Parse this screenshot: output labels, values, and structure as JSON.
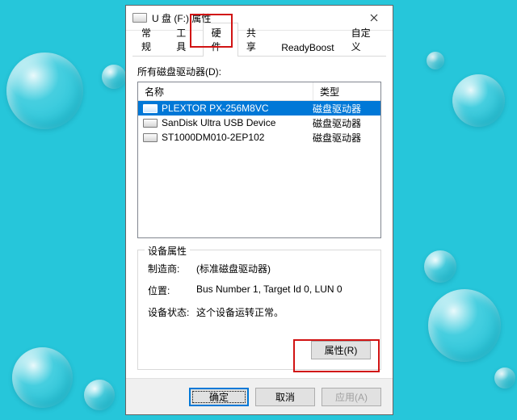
{
  "window": {
    "title": "U 盘 (F:) 属性"
  },
  "tabs": {
    "items": [
      {
        "label": "常规"
      },
      {
        "label": "工具"
      },
      {
        "label": "硬件"
      },
      {
        "label": "共享"
      },
      {
        "label": "ReadyBoost"
      },
      {
        "label": "自定义"
      }
    ],
    "active_index": 2
  },
  "list": {
    "caption": "所有磁盘驱动器(D):",
    "col_name": "名称",
    "col_type": "类型",
    "rows": [
      {
        "name": "PLEXTOR PX-256M8VC",
        "type": "磁盘驱动器",
        "selected": true
      },
      {
        "name": "SanDisk Ultra USB Device",
        "type": "磁盘驱动器",
        "selected": false
      },
      {
        "name": "ST1000DM010-2EP102",
        "type": "磁盘驱动器",
        "selected": false
      }
    ]
  },
  "device_props": {
    "legend": "设备属性",
    "manufacturer_label": "制造商:",
    "manufacturer_value": "(标准磁盘驱动器)",
    "location_label": "位置:",
    "location_value": "Bus Number 1, Target Id 0, LUN 0",
    "status_label": "设备状态:",
    "status_value": "这个设备运转正常。",
    "properties_button": "属性(R)"
  },
  "footer": {
    "ok": "确定",
    "cancel": "取消",
    "apply": "应用(A)"
  }
}
